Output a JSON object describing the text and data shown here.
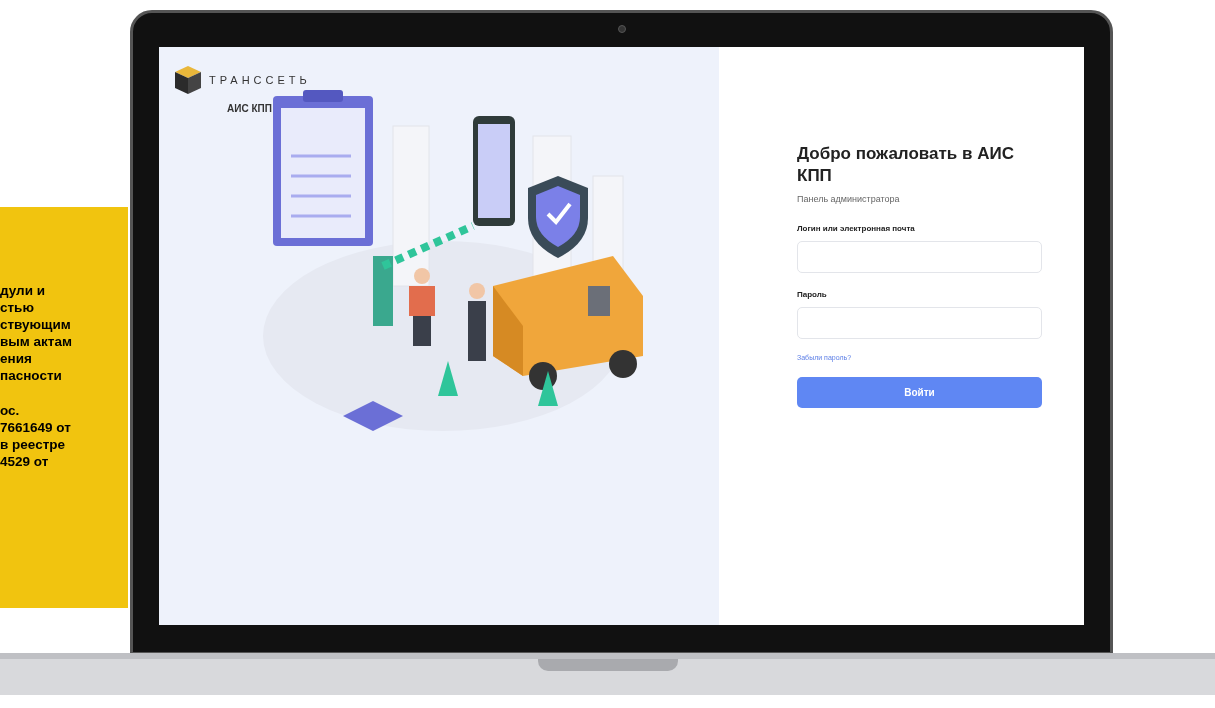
{
  "side_note": {
    "paragraphs": [
      "дули и\nстью\nствующим\nвым актам\nения\nпасности",
      "ос.\n7661649 от\nв реестре\n4529 от"
    ]
  },
  "screen": {
    "brand": {
      "name": "ТРАНССЕТЬ",
      "product": "АИС КПП"
    },
    "login": {
      "title": "Добро пожаловать в АИС КПП",
      "subtitle": "Панель администратора",
      "fields": [
        {
          "label": "Логин или электронная почта"
        },
        {
          "label": "Пароль"
        }
      ],
      "forgot_link": "Забыли пароль?",
      "submit": "Войти"
    }
  }
}
